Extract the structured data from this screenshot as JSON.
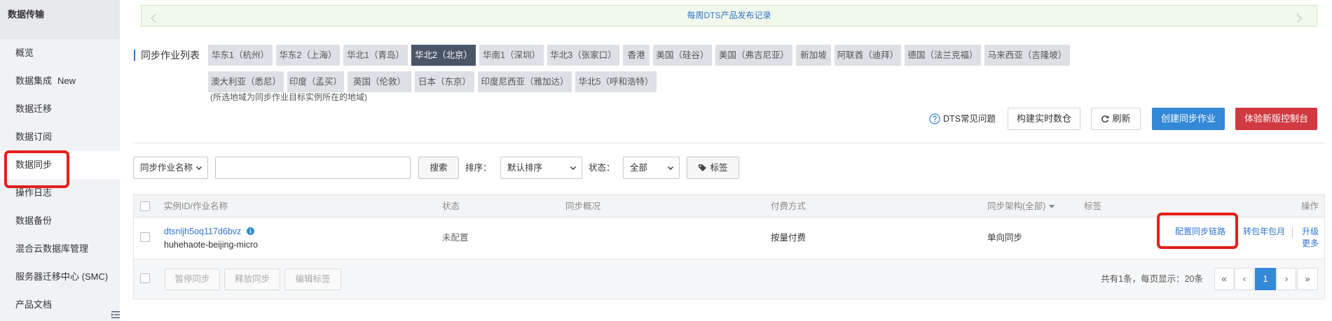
{
  "colors": {
    "accent": "#3488d8",
    "danger": "#d03a40",
    "link": "#2f74d0",
    "active_tab": "#4b5568",
    "highlight": "#e3201c",
    "notice_text": "#2f72c8"
  },
  "icons": {
    "collapse": "collapse-sidebar-icon",
    "notice_prev": "chevron-left-icon",
    "notice_next": "chevron-right-icon",
    "help": "help-circle-icon",
    "refresh": "refresh-icon",
    "select": "chevron-down-icon",
    "tag": "tag-icon",
    "info": "info-icon",
    "sort": "caret-down-icon"
  },
  "sidebar": {
    "title": "数据传输",
    "items": [
      {
        "label": "概览"
      },
      {
        "label": "数据集成",
        "badge": "New"
      },
      {
        "label": "数据迁移"
      },
      {
        "label": "数据订阅"
      },
      {
        "label": "数据同步",
        "active": true
      },
      {
        "label": "操作日志"
      },
      {
        "label": "数据备份"
      },
      {
        "label": "混合云数据库管理"
      },
      {
        "label": "服务器迁移中心 (SMC)"
      },
      {
        "label": "产品文档"
      }
    ]
  },
  "notice": {
    "text": "每周DTS产品发布记录"
  },
  "regions": {
    "label": "同步作业列表",
    "tabs": [
      {
        "label": "华东1（杭州）"
      },
      {
        "label": "华东2（上海）"
      },
      {
        "label": "华北1（青岛）"
      },
      {
        "label": "华北2（北京）",
        "active": true
      },
      {
        "label": "华南1（深圳）"
      },
      {
        "label": "华北3（张家口）"
      },
      {
        "label": "香港"
      },
      {
        "label": "美国（硅谷）"
      },
      {
        "label": "美国（弗吉尼亚）"
      },
      {
        "label": "新加坡"
      },
      {
        "label": "阿联酋（迪拜）"
      },
      {
        "label": "德国（法兰克福）"
      },
      {
        "label": "马来西亚（吉隆坡）"
      },
      {
        "label": "澳大利亚（悉尼）"
      },
      {
        "label": "印度（孟买）"
      },
      {
        "label": "英国（伦敦）"
      },
      {
        "label": "日本（东京）"
      },
      {
        "label": "印度尼西亚（雅加达）"
      },
      {
        "label": "华北5（呼和浩特）"
      }
    ],
    "note": "(所选地域为同步作业目标实例所在的地域)"
  },
  "toolbar": {
    "faq": "DTS常见问题",
    "build_warehouse": "构建实时数仓",
    "refresh": "刷新",
    "create": "创建同步作业",
    "new_console": "体验新版控制台"
  },
  "filters": {
    "field": "同步作业名称",
    "search_button": "搜索",
    "sort_label": "排序：",
    "sort": "默认排序",
    "status_label": "状态：",
    "status": "全部",
    "tag_button": "标签"
  },
  "table": {
    "columns": [
      "实例ID/作业名称",
      "状态",
      "同步概况",
      "付费方式",
      "同步架构(全部)",
      "标签",
      "操作"
    ],
    "rows": [
      {
        "instance_id": "dtsnljh5oq117d6bvz",
        "job_name": "huhehaote-beijing-micro",
        "status": "未配置",
        "billing": "按量付费",
        "architecture": "单向同步",
        "actions": {
          "configure": "配置同步链路",
          "convert": "转包年包月",
          "upgrade": "升级",
          "more": "更多"
        }
      }
    ]
  },
  "footer": {
    "batch_actions": [
      "暂停同步",
      "释放同步",
      "编辑标签"
    ],
    "summary": "共有1条，每页显示：20条",
    "pagination": {
      "first": "«",
      "prev": "‹",
      "current": "1",
      "next": "›",
      "last": "»"
    }
  }
}
